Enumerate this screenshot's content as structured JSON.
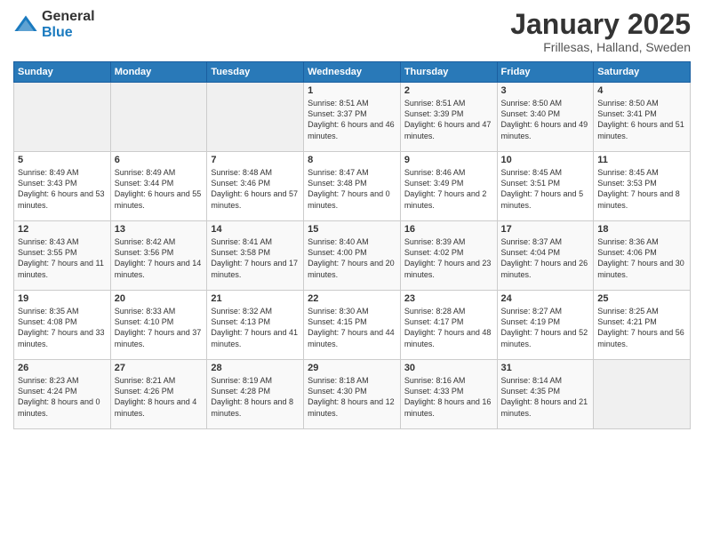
{
  "logo": {
    "general": "General",
    "blue": "Blue"
  },
  "title": "January 2025",
  "subtitle": "Frillesas, Halland, Sweden",
  "days": [
    "Sunday",
    "Monday",
    "Tuesday",
    "Wednesday",
    "Thursday",
    "Friday",
    "Saturday"
  ],
  "weeks": [
    [
      {
        "day": "",
        "content": ""
      },
      {
        "day": "",
        "content": ""
      },
      {
        "day": "",
        "content": ""
      },
      {
        "day": "1",
        "content": "Sunrise: 8:51 AM\nSunset: 3:37 PM\nDaylight: 6 hours and 46 minutes."
      },
      {
        "day": "2",
        "content": "Sunrise: 8:51 AM\nSunset: 3:39 PM\nDaylight: 6 hours and 47 minutes."
      },
      {
        "day": "3",
        "content": "Sunrise: 8:50 AM\nSunset: 3:40 PM\nDaylight: 6 hours and 49 minutes."
      },
      {
        "day": "4",
        "content": "Sunrise: 8:50 AM\nSunset: 3:41 PM\nDaylight: 6 hours and 51 minutes."
      }
    ],
    [
      {
        "day": "5",
        "content": "Sunrise: 8:49 AM\nSunset: 3:43 PM\nDaylight: 6 hours and 53 minutes."
      },
      {
        "day": "6",
        "content": "Sunrise: 8:49 AM\nSunset: 3:44 PM\nDaylight: 6 hours and 55 minutes."
      },
      {
        "day": "7",
        "content": "Sunrise: 8:48 AM\nSunset: 3:46 PM\nDaylight: 6 hours and 57 minutes."
      },
      {
        "day": "8",
        "content": "Sunrise: 8:47 AM\nSunset: 3:48 PM\nDaylight: 7 hours and 0 minutes."
      },
      {
        "day": "9",
        "content": "Sunrise: 8:46 AM\nSunset: 3:49 PM\nDaylight: 7 hours and 2 minutes."
      },
      {
        "day": "10",
        "content": "Sunrise: 8:45 AM\nSunset: 3:51 PM\nDaylight: 7 hours and 5 minutes."
      },
      {
        "day": "11",
        "content": "Sunrise: 8:45 AM\nSunset: 3:53 PM\nDaylight: 7 hours and 8 minutes."
      }
    ],
    [
      {
        "day": "12",
        "content": "Sunrise: 8:43 AM\nSunset: 3:55 PM\nDaylight: 7 hours and 11 minutes."
      },
      {
        "day": "13",
        "content": "Sunrise: 8:42 AM\nSunset: 3:56 PM\nDaylight: 7 hours and 14 minutes."
      },
      {
        "day": "14",
        "content": "Sunrise: 8:41 AM\nSunset: 3:58 PM\nDaylight: 7 hours and 17 minutes."
      },
      {
        "day": "15",
        "content": "Sunrise: 8:40 AM\nSunset: 4:00 PM\nDaylight: 7 hours and 20 minutes."
      },
      {
        "day": "16",
        "content": "Sunrise: 8:39 AM\nSunset: 4:02 PM\nDaylight: 7 hours and 23 minutes."
      },
      {
        "day": "17",
        "content": "Sunrise: 8:37 AM\nSunset: 4:04 PM\nDaylight: 7 hours and 26 minutes."
      },
      {
        "day": "18",
        "content": "Sunrise: 8:36 AM\nSunset: 4:06 PM\nDaylight: 7 hours and 30 minutes."
      }
    ],
    [
      {
        "day": "19",
        "content": "Sunrise: 8:35 AM\nSunset: 4:08 PM\nDaylight: 7 hours and 33 minutes."
      },
      {
        "day": "20",
        "content": "Sunrise: 8:33 AM\nSunset: 4:10 PM\nDaylight: 7 hours and 37 minutes."
      },
      {
        "day": "21",
        "content": "Sunrise: 8:32 AM\nSunset: 4:13 PM\nDaylight: 7 hours and 41 minutes."
      },
      {
        "day": "22",
        "content": "Sunrise: 8:30 AM\nSunset: 4:15 PM\nDaylight: 7 hours and 44 minutes."
      },
      {
        "day": "23",
        "content": "Sunrise: 8:28 AM\nSunset: 4:17 PM\nDaylight: 7 hours and 48 minutes."
      },
      {
        "day": "24",
        "content": "Sunrise: 8:27 AM\nSunset: 4:19 PM\nDaylight: 7 hours and 52 minutes."
      },
      {
        "day": "25",
        "content": "Sunrise: 8:25 AM\nSunset: 4:21 PM\nDaylight: 7 hours and 56 minutes."
      }
    ],
    [
      {
        "day": "26",
        "content": "Sunrise: 8:23 AM\nSunset: 4:24 PM\nDaylight: 8 hours and 0 minutes."
      },
      {
        "day": "27",
        "content": "Sunrise: 8:21 AM\nSunset: 4:26 PM\nDaylight: 8 hours and 4 minutes."
      },
      {
        "day": "28",
        "content": "Sunrise: 8:19 AM\nSunset: 4:28 PM\nDaylight: 8 hours and 8 minutes."
      },
      {
        "day": "29",
        "content": "Sunrise: 8:18 AM\nSunset: 4:30 PM\nDaylight: 8 hours and 12 minutes."
      },
      {
        "day": "30",
        "content": "Sunrise: 8:16 AM\nSunset: 4:33 PM\nDaylight: 8 hours and 16 minutes."
      },
      {
        "day": "31",
        "content": "Sunrise: 8:14 AM\nSunset: 4:35 PM\nDaylight: 8 hours and 21 minutes."
      },
      {
        "day": "",
        "content": ""
      }
    ]
  ]
}
